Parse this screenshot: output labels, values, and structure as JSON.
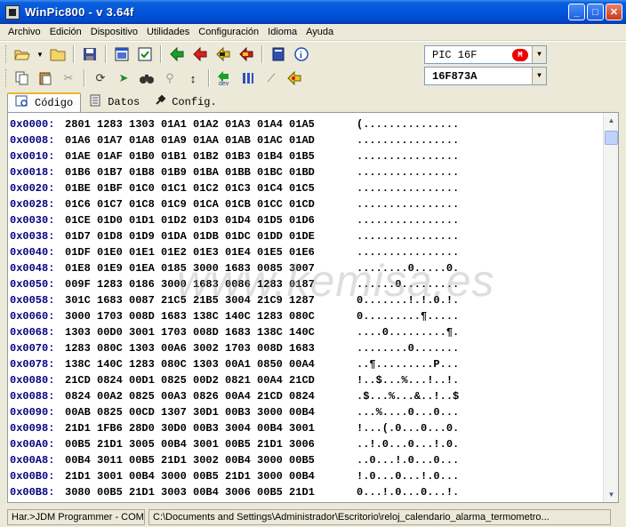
{
  "window": {
    "title": "WinPic800   -  v 3.64f",
    "min": "_",
    "max": "□",
    "close": "✕"
  },
  "menu": [
    "Archivo",
    "Edición",
    "Dispositivo",
    "Utilidades",
    "Configuración",
    "Idioma",
    "Ayuda"
  ],
  "toolbar": {
    "row1": [
      "open-folder-icon",
      "dropdown-arrow-icon",
      "folder-icon",
      "save-disk-icon",
      "window-icon",
      "checked-window-icon",
      "read-chip-icon",
      "write-chip-icon",
      "verify-chip-icon",
      "erase-chip-icon"
    ],
    "row2": [
      "copy-icon",
      "paste-icon",
      "cut-icon",
      "refresh-icon",
      "cursor-icon",
      "search-binoculars-icon",
      "find-replace-icon",
      "vertical-arrows-icon",
      "dev-icon",
      "columns-icon",
      "probe-icon",
      "burn-icon",
      "book-icon",
      "info-icon"
    ]
  },
  "device": {
    "family": "PIC 16F",
    "model": "16F873A",
    "vendor_logo": "microchip-logo-icon"
  },
  "tabs": [
    {
      "label": "Código",
      "icon": "code-tab-icon",
      "active": true
    },
    {
      "label": "Datos",
      "icon": "data-tab-icon",
      "active": false
    },
    {
      "label": "Config.",
      "icon": "config-tab-icon",
      "active": false
    }
  ],
  "hexdump": [
    {
      "addr": "0x0000:",
      "hex": "2801 1283 1303 01A1 01A2 01A3 01A4 01A5",
      "ascii": "(..............."
    },
    {
      "addr": "0x0008:",
      "hex": "01A6 01A7 01A8 01A9 01AA 01AB 01AC 01AD",
      "ascii": "................"
    },
    {
      "addr": "0x0010:",
      "hex": "01AE 01AF 01B0 01B1 01B2 01B3 01B4 01B5",
      "ascii": "................"
    },
    {
      "addr": "0x0018:",
      "hex": "01B6 01B7 01B8 01B9 01BA 01BB 01BC 01BD",
      "ascii": "................"
    },
    {
      "addr": "0x0020:",
      "hex": "01BE 01BF 01C0 01C1 01C2 01C3 01C4 01C5",
      "ascii": "................"
    },
    {
      "addr": "0x0028:",
      "hex": "01C6 01C7 01C8 01C9 01CA 01CB 01CC 01CD",
      "ascii": "................"
    },
    {
      "addr": "0x0030:",
      "hex": "01CE 01D0 01D1 01D2 01D3 01D4 01D5 01D6",
      "ascii": "................"
    },
    {
      "addr": "0x0038:",
      "hex": "01D7 01D8 01D9 01DA 01DB 01DC 01DD 01DE",
      "ascii": "................"
    },
    {
      "addr": "0x0040:",
      "hex": "01DF 01E0 01E1 01E2 01E3 01E4 01E5 01E6",
      "ascii": "................"
    },
    {
      "addr": "0x0048:",
      "hex": "01E8 01E9 01EA 0185 3000 1683 0085 3007",
      "ascii": "........0.....0."
    },
    {
      "addr": "0x0050:",
      "hex": "009F 1283 0186 3000 1683 0086 1283 0187",
      "ascii": "......0........."
    },
    {
      "addr": "0x0058:",
      "hex": "301C 1683 0087 21C5 21B5 3004 21C9 1287",
      "ascii": "0.......!.!.0.!."
    },
    {
      "addr": "0x0060:",
      "hex": "3000 1703 008D 1683 138C 140C 1283 080C",
      "ascii": "0.........¶....."
    },
    {
      "addr": "0x0068:",
      "hex": "1303 00D0 3001 1703 008D 1683 138C 140C",
      "ascii": "....0.........¶."
    },
    {
      "addr": "0x0070:",
      "hex": "1283 080C 1303 00A6 3002 1703 008D 1683",
      "ascii": "........0......."
    },
    {
      "addr": "0x0078:",
      "hex": "138C 140C 1283 080C 1303 00A1 0850 00A4",
      "ascii": "..¶.........P..."
    },
    {
      "addr": "0x0080:",
      "hex": "21CD 0824 00D1 0825 00D2 0821 00A4 21CD",
      "ascii": "!..$...%...!..!."
    },
    {
      "addr": "0x0088:",
      "hex": "0824 00A2 0825 00A3 0826 00A4 21CD 0824",
      "ascii": ".$...%...&..!..$"
    },
    {
      "addr": "0x0090:",
      "hex": "00AB 0825 00CD 1307 30D1 00B3 3000 00B4",
      "ascii": "...%....0...0..."
    },
    {
      "addr": "0x0098:",
      "hex": "21D1 1FB6 28D0 30D0 00B3 3004 00B4 3001",
      "ascii": "!...(.0...0...0."
    },
    {
      "addr": "0x00A0:",
      "hex": "00B5 21D1 3005 00B4 3001 00B5 21D1 3006",
      "ascii": "..!.0...0...!.0."
    },
    {
      "addr": "0x00A8:",
      "hex": "00B4 3011 00B5 21D1 3002 00B4 3000 00B5",
      "ascii": "..0...!.0...0..."
    },
    {
      "addr": "0x00B0:",
      "hex": "21D1 3001 00B4 3000 00B5 21D1 3000 00B4",
      "ascii": "!.0...0...!.0..."
    },
    {
      "addr": "0x00B8:",
      "hex": "3080 00B5 21D1 3003 00B4 3006 00B5 21D1",
      "ascii": "0...!.0...0...!."
    }
  ],
  "watermark": "www.kemisa.es",
  "status": {
    "hardware": "Har.>JDM Programmer - COM1",
    "path": "C:\\Documents and Settings\\Administrador\\Escritorio\\reloj_calendario_alarma_termometro..."
  }
}
